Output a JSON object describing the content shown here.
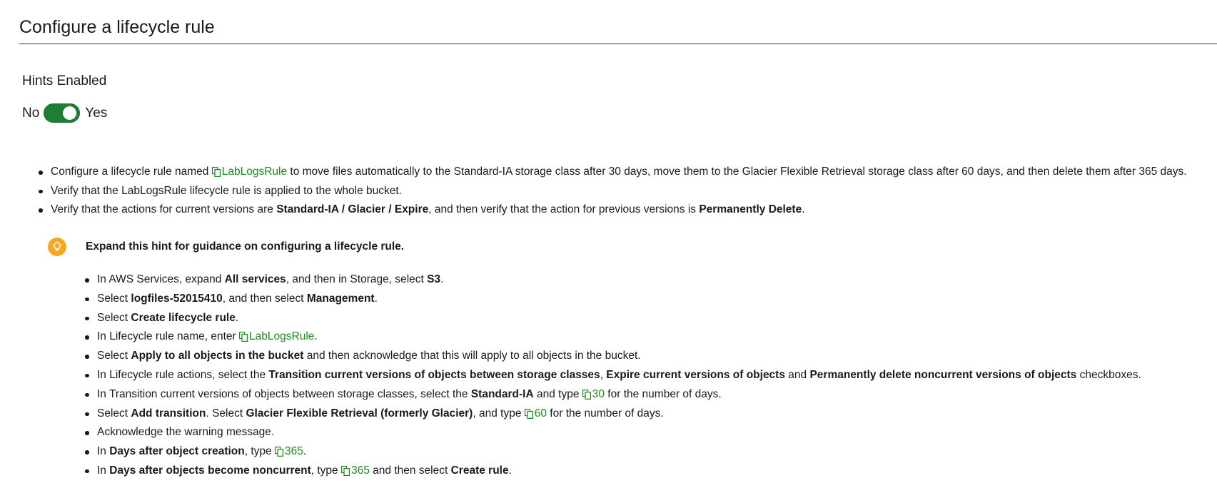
{
  "header": {
    "title": "Configure a lifecycle rule"
  },
  "hints": {
    "label": "Hints Enabled",
    "no_label": "No",
    "yes_label": "Yes",
    "enabled": true
  },
  "tasks": {
    "t1": {
      "a": "Configure a lifecycle rule named ",
      "copy": "LabLogsRule",
      "b": " to move files automatically to the Standard-IA storage class after 30 days, move them to the Glacier Flexible Retrieval storage class after 60 days, and then delete them after 365 days."
    },
    "t2": {
      "a": "Verify that the LabLogsRule lifecycle rule is applied to the whole bucket."
    },
    "t3": {
      "a": "Verify that the actions for current versions are ",
      "b1": "Standard-IA / Glacier / Expire",
      "c": ", and then verify that the action for previous versions is ",
      "b2": "Permanently Delete",
      "d": "."
    }
  },
  "hint": {
    "icon": "lightbulb-icon",
    "title": "Expand this hint for guidance on configuring a lifecycle rule.",
    "steps": {
      "s1": {
        "a": "In AWS Services, expand ",
        "b1": "All services",
        "c": ", and then in Storage, select ",
        "b2": "S3",
        "d": "."
      },
      "s2": {
        "a": "Select ",
        "b1": "logfiles-52015410",
        "c": ", and then select ",
        "b2": "Management",
        "d": "."
      },
      "s3": {
        "a": "Select ",
        "b1": "Create lifecycle rule",
        "d": "."
      },
      "s4": {
        "a": "In Lifecycle rule name, enter ",
        "copy": "LabLogsRule",
        "d": "."
      },
      "s5": {
        "a": "Select ",
        "b1": "Apply to all objects in the bucket",
        "c": " and then acknowledge that this will apply to all objects in the bucket."
      },
      "s6": {
        "a": "In Lifecycle rule actions, select the ",
        "b1": "Transition current versions of objects between storage classes",
        "c": ", ",
        "b2": "Expire current versions of objects",
        "e": " and ",
        "b3": "Permanently delete noncurrent versions of objects",
        "f": " checkboxes."
      },
      "s7": {
        "a": "In Transition current versions of objects between storage classes, select the ",
        "b1": "Standard-IA",
        "c": " and type ",
        "copy": "30",
        "d": " for the number of days."
      },
      "s8": {
        "a": "Select ",
        "b1": "Add transition",
        "c": ". Select ",
        "b2": "Glacier Flexible Retrieval (formerly Glacier)",
        "e": ", and type ",
        "copy": "60",
        "d": " for the number of days."
      },
      "s9": {
        "a": "Acknowledge the warning message."
      },
      "s10": {
        "a": "In ",
        "b1": "Days after object creation",
        "c": ", type ",
        "copy": "365",
        "d": "."
      },
      "s11": {
        "a": "In ",
        "b1": "Days after objects become noncurrent",
        "c": ", type ",
        "copy": "365",
        "e": " and then select ",
        "b2": "Create rule",
        "d": "."
      }
    }
  },
  "colors": {
    "toggle_on": "#1e7e34",
    "copy_text": "#1f8a1f",
    "bulb": "#f5a623"
  }
}
